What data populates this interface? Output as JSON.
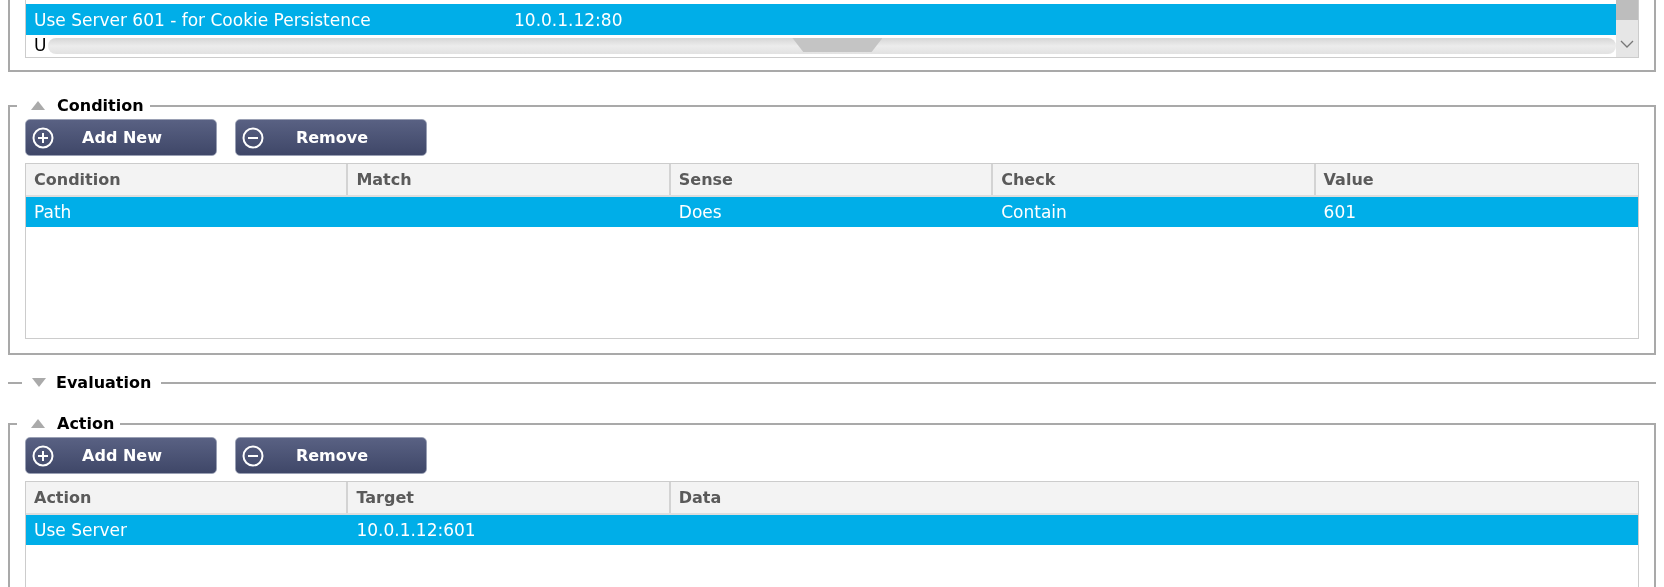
{
  "top_list": {
    "rows": [
      {
        "name": "Use Server 601 - for Cookie Persistence",
        "address": "10.0.1.12:80",
        "selected": true
      },
      {
        "name": "U",
        "selected": false
      }
    ]
  },
  "sections": [
    {
      "title": "Condition",
      "expanded": true,
      "buttons": [
        {
          "label": "Add New",
          "kind": "add"
        },
        {
          "label": "Remove",
          "kind": "remove"
        }
      ],
      "table": {
        "columns": [
          "Condition",
          "Match",
          "Sense",
          "Check",
          "Value"
        ],
        "rows": [
          {
            "cells": [
              "Path",
              null,
              "Does",
              "Contain",
              "601"
            ],
            "selected": true
          }
        ]
      }
    },
    {
      "title": "Evaluation",
      "expanded": false
    },
    {
      "title": "Action",
      "expanded": true,
      "buttons": [
        {
          "label": "Add New",
          "kind": "add"
        },
        {
          "label": "Remove",
          "kind": "remove"
        }
      ],
      "table": {
        "columns": [
          "Action",
          "Target",
          "Data"
        ],
        "rows": [
          {
            "cells": [
              "Use Server",
              "10.0.1.12:601"
            ],
            "selected": true
          }
        ]
      }
    }
  ]
}
